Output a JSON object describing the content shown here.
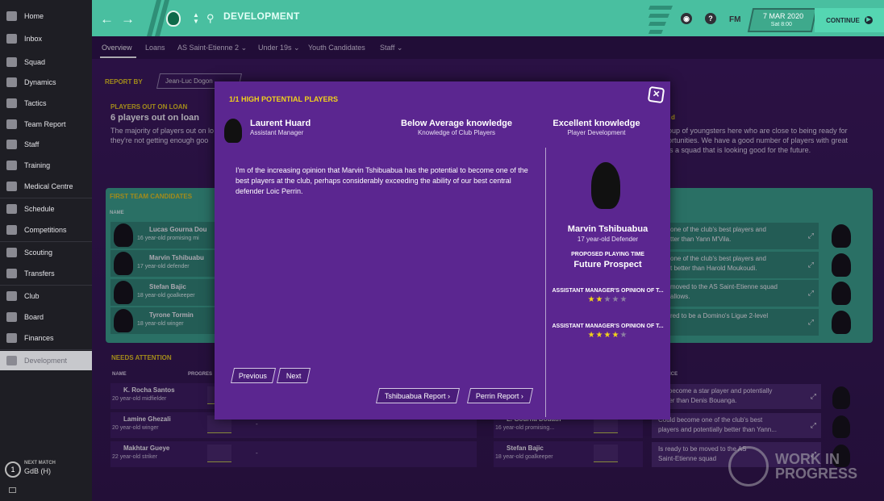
{
  "sidebar": {
    "items": [
      {
        "label": "Home"
      },
      {
        "label": "Inbox"
      },
      {
        "label": "Squad"
      },
      {
        "label": "Dynamics"
      },
      {
        "label": "Tactics"
      },
      {
        "label": "Team Report"
      },
      {
        "label": "Staff"
      },
      {
        "label": "Training"
      },
      {
        "label": "Medical Centre"
      },
      {
        "label": "Schedule"
      },
      {
        "label": "Competitions"
      },
      {
        "label": "Scouting"
      },
      {
        "label": "Transfers"
      },
      {
        "label": "Club"
      },
      {
        "label": "Board"
      },
      {
        "label": "Finances"
      },
      {
        "label": "Development"
      }
    ],
    "next_match_label": "NEXT MATCH",
    "next_match_value": "GdB (H)"
  },
  "header": {
    "title": "DEVELOPMENT",
    "date": "7 MAR 2020",
    "time": "Sat 8:00",
    "continue_label": "CONTINUE",
    "fm_logo": "FM",
    "help_icon_glyph": "?",
    "accent_color": "#49bfa0"
  },
  "subtabs": [
    "Overview",
    "Loans",
    "AS Saint-Etienne 2",
    "Under 19s",
    "Youth Candidates",
    "Staff"
  ],
  "background": {
    "report_by_label": "REPORT BY",
    "report_by_value": "Jean-Luc Dogon",
    "loan_label": "PLAYERS OUT ON LOAN",
    "loan_big": "6 players out on loan",
    "loan_text1": "The majority of players out on lo",
    "loan_text2": "they're not getting enough goo",
    "right_text_heading": "d",
    "right_text1": "oup of youngsters here who are close to being ready for",
    "right_text2": "ortunities. We have a good number of players with great",
    "right_text3": "is a squad that is looking good for the future.",
    "candidates_label": "FIRST TEAM CANDIDATES",
    "name_col": "NAME",
    "candidates": [
      {
        "name": "Lucas Gourna Dou",
        "desc": "16 year-old promising mi"
      },
      {
        "name": "Marvin Tshibuabu",
        "desc": "17 year-old defender"
      },
      {
        "name": "Stefan Bajic",
        "desc": "18 year-old goalkeeper"
      },
      {
        "name": "Tyrone Tormin",
        "desc": "18 year-old winger"
      }
    ],
    "candidate_advice": [
      "one of the club's best players and\ntter than Yann M'Vila.",
      "one of the club's best players and\nt better than Harold Moukoudi.",
      "moved to the AS Saint-Etienne squad\n allows.",
      "red to be a Domino's Ligue 2-level"
    ],
    "attention_label": "NEEDS ATTENTION",
    "att_name_col": "NAME",
    "att_progress_col": "PROGRES",
    "attention": [
      {
        "name": "K. Rocha Santos",
        "desc": "20 year-old midfielder",
        "value": ""
      },
      {
        "name": "Lamine Ghezali",
        "desc": "20 year-old winger",
        "value": "-"
      },
      {
        "name": "Makhtar Gueye",
        "desc": "22 year-old striker",
        "value": "-"
      }
    ],
    "right_attention_rows": [
      {
        "name": "L. Gourna Douath",
        "desc": "16 year-old promising..."
      },
      {
        "name": "Stefan Bajic",
        "desc": "18 year-old goalkeeper"
      }
    ],
    "right_advice_col": "ENT ADVICE",
    "right_advice": [
      "uld become a star player and potentially\nbetter than Denis Bouanga.",
      "Could become one of the club's best\nplayers and potentially better than Yann...",
      "Is ready to be moved to the AS\nSaint-Etienne squad"
    ],
    "watermark_line1": "WORK IN",
    "watermark_line2": "PROGRESS"
  },
  "modal": {
    "title": "1/1 HIGH POTENTIAL PLAYERS",
    "coach_name": "Laurent Huard",
    "coach_role": "Assistant Manager",
    "knowledge1_title": "Below Average knowledge",
    "knowledge1_sub": "Knowledge of Club Players",
    "knowledge2_title": "Excellent knowledge",
    "knowledge2_sub": "Player Development",
    "report_text": "I'm of the increasing opinion that Marvin Tshibuabua has the potential to become one of the best players at the club, perhaps considerably exceeding the ability of our best central defender Loic Perrin.",
    "player_name": "Marvin Tshibuabua",
    "player_desc": "17 year-old Defender",
    "proposed_playing_time_label": "PROPOSED PLAYING TIME",
    "proposed_playing_time_value": "Future Prospect",
    "opinion1_label": "ASSISTANT MANAGER'S OPINION OF T...",
    "opinion1_stars": 2,
    "opinion2_label": "ASSISTANT MANAGER'S OPINION OF T...",
    "opinion2_stars": 4,
    "previous_label": "Previous",
    "next_label": "Next",
    "report1_label": "Tshibuabua Report",
    "report2_label": "Perrin Report"
  }
}
